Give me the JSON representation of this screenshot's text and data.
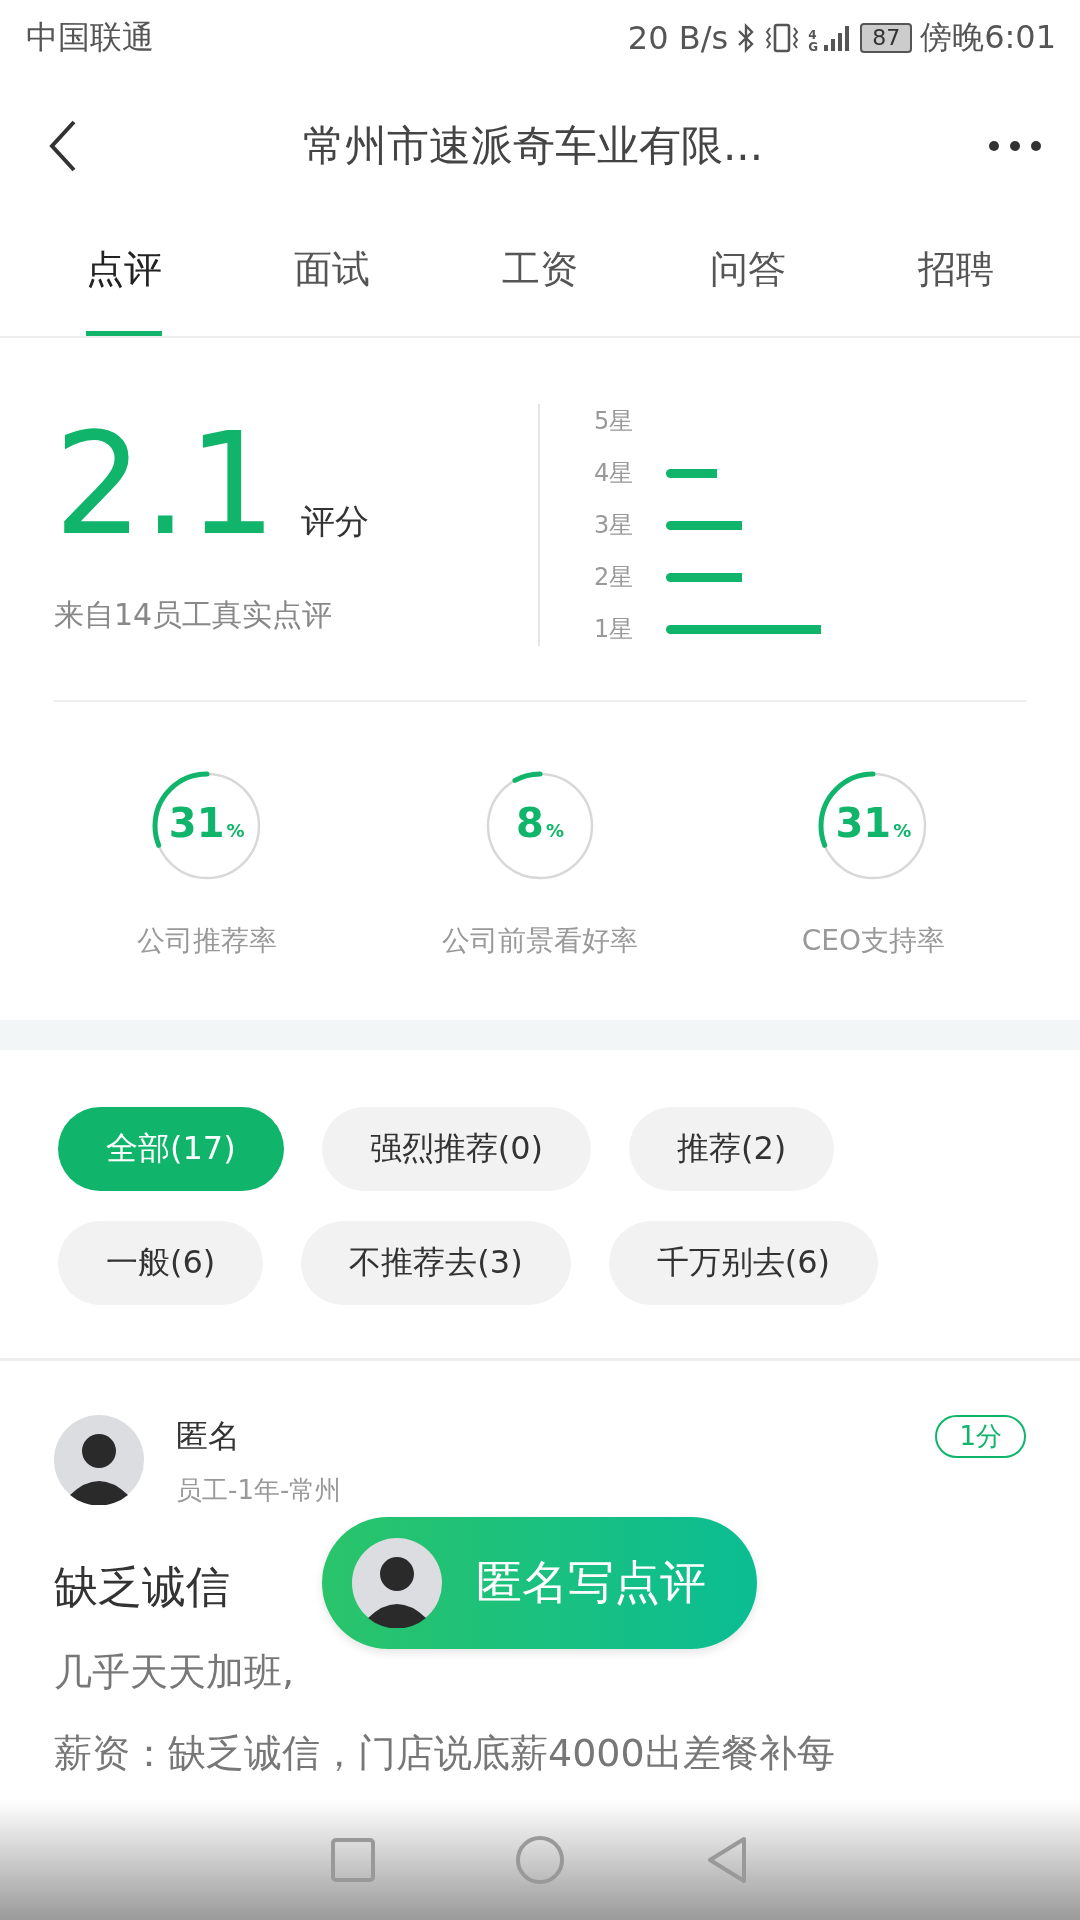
{
  "status_bar": {
    "carrier": "中国联通",
    "speed": "20 B/s",
    "network": "4G",
    "battery": "87",
    "time": "傍晚6:01"
  },
  "header": {
    "title": "常州市速派奇车业有限..."
  },
  "tabs": [
    {
      "label": "点评",
      "selected": true
    },
    {
      "label": "面试",
      "selected": false
    },
    {
      "label": "工资",
      "selected": false
    },
    {
      "label": "问答",
      "selected": false
    },
    {
      "label": "招聘",
      "selected": false
    }
  ],
  "rating": {
    "score": "2.1",
    "score_label": "评分",
    "source": "来自14员工真实点评",
    "distribution": [
      {
        "label": "5星"
      },
      {
        "label": "4星"
      },
      {
        "label": "3星"
      },
      {
        "label": "2星"
      },
      {
        "label": "1星"
      }
    ]
  },
  "rates": [
    {
      "value": "31",
      "unit": "%",
      "label": "公司推荐率"
    },
    {
      "value": "8",
      "unit": "%",
      "label": "公司前景看好率"
    },
    {
      "value": "31",
      "unit": "%",
      "label": "CEO支持率"
    }
  ],
  "filters": [
    {
      "label": "全部(17)",
      "selected": true
    },
    {
      "label": "强烈推荐(0)",
      "selected": false
    },
    {
      "label": "推荐(2)",
      "selected": false
    },
    {
      "label": "一般(6)",
      "selected": false
    },
    {
      "label": "不推荐去(3)",
      "selected": false
    },
    {
      "label": "千万别去(6)",
      "selected": false
    }
  ],
  "review": {
    "author": "匿名",
    "meta": "员工-1年-常州",
    "score": "1分",
    "title": "缺乏诚信",
    "summary": "几乎天天加班,",
    "body": "薪资：缺乏诚信，门店说底薪4000出差餐补每"
  },
  "fab": {
    "label": "匿名写点评"
  }
}
